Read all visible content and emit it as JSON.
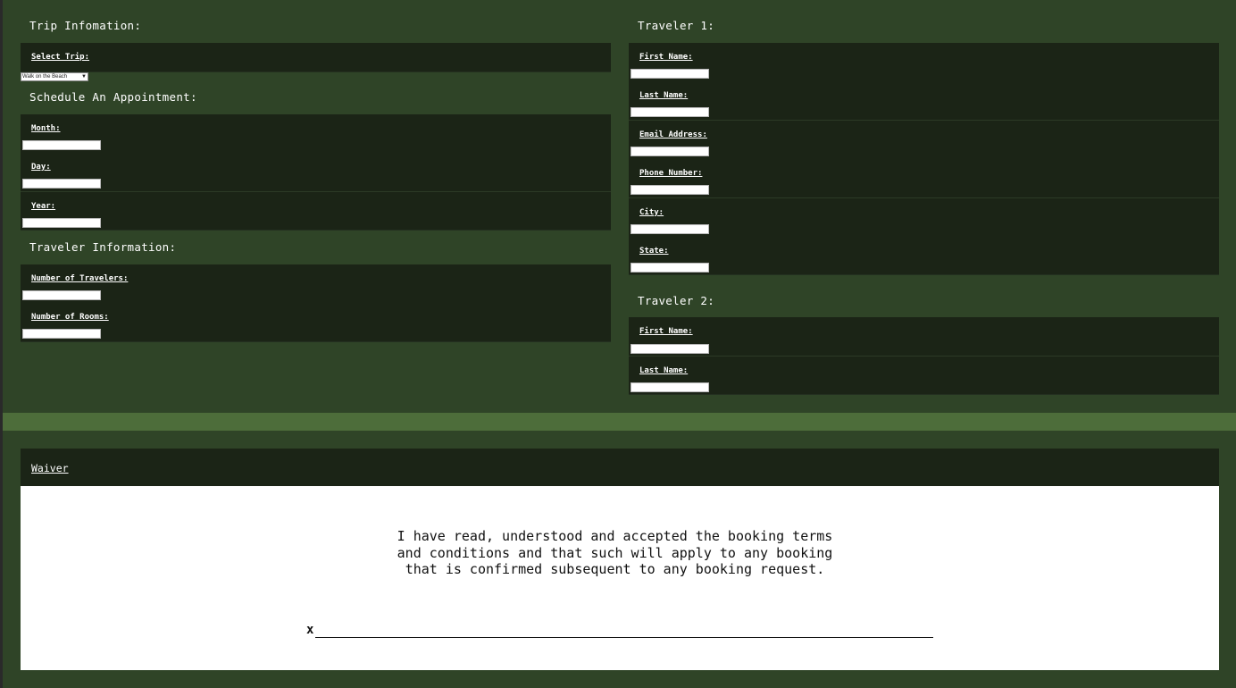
{
  "trip": {
    "title": "Trip Infomation:",
    "select_label": "Select Trip:",
    "selected_trip": "Walk on the Beach"
  },
  "schedule": {
    "title": "Schedule An Appointment:",
    "month_label": "Month:",
    "day_label": "Day:",
    "year_label": "Year:"
  },
  "traveler_info": {
    "title": "Traveler Information:",
    "num_travelers_label": "Number of Travelers:",
    "num_rooms_label": "Number of Rooms:"
  },
  "traveler1": {
    "title": "Traveler 1:",
    "first_name_label": "First Name:",
    "last_name_label": "Last Name:",
    "email_label": "Email Address:",
    "phone_label": "Phone Number:",
    "city_label": "City:",
    "state_label": "State:"
  },
  "traveler2": {
    "title": "Traveler 2:",
    "first_name_label": "First Name:",
    "last_name_label": "Last Name:"
  },
  "waiver": {
    "title": "Waiver",
    "text_line1": "I have read, understood and accepted the booking terms",
    "text_line2": "and conditions and that such will apply to any booking",
    "text_line3": "that is confirmed subsequent to any booking request.",
    "signature_mark": "x"
  },
  "colors": {
    "page_bg": "#2f4427",
    "panel_bg": "#1b2416",
    "band": "#4d6d3a"
  },
  "icons": {
    "select_caret": "chevron-down-icon"
  }
}
